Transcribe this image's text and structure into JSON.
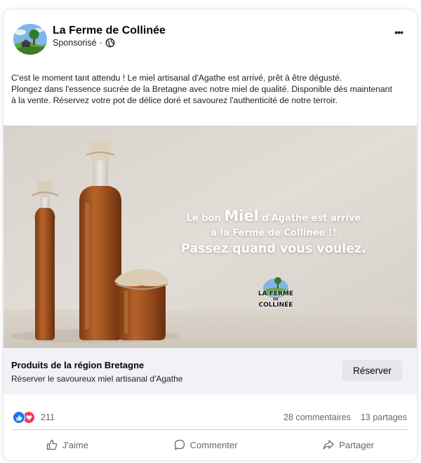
{
  "post": {
    "page_name": "La Ferme de Collinée",
    "sponsored_label": "Sponsorisé",
    "separator": "·",
    "text_lines": [
      "C'est le moment tant attendu ! Le miel artisanal d'Agathe est arrivé, prêt à être dégusté.",
      "Plongez dans l'essence sucrée de la Bretagne avec notre miel de qualité.  Disponible dès maintenant",
      "à la vente. Réservez votre pot de délice doré et savourez l'authenticité de notre terroir."
    ]
  },
  "media": {
    "overlay_line1_pre": "Le bon ",
    "overlay_line1_big": "Miel",
    "overlay_line1_post": " d'Agathe est arrivé",
    "overlay_line2": "à la Ferme de Collinée !!",
    "overlay_line3": "Passez quand vous voulez.",
    "logo_line1": "LA FERME",
    "logo_line2": "DE",
    "logo_line3": "COLLINÉE"
  },
  "cta": {
    "title": "Produits de la région Bretagne",
    "subtitle": "Réserver le savoureux miel artisanal d'Agathe",
    "button_label": "Réserver"
  },
  "engagement": {
    "reaction_count": "211",
    "comments": "28 commentaires",
    "shares": "13 partages",
    "reaction_icons": [
      "like-icon",
      "love-icon"
    ]
  },
  "actions": {
    "like": "J'aime",
    "comment": "Commenter",
    "share": "Partager"
  },
  "colors": {
    "like_blue": "#1877f2",
    "love_red": "#f33e58",
    "honey": "#a8541f",
    "cta_background": "#f0f2f5"
  }
}
